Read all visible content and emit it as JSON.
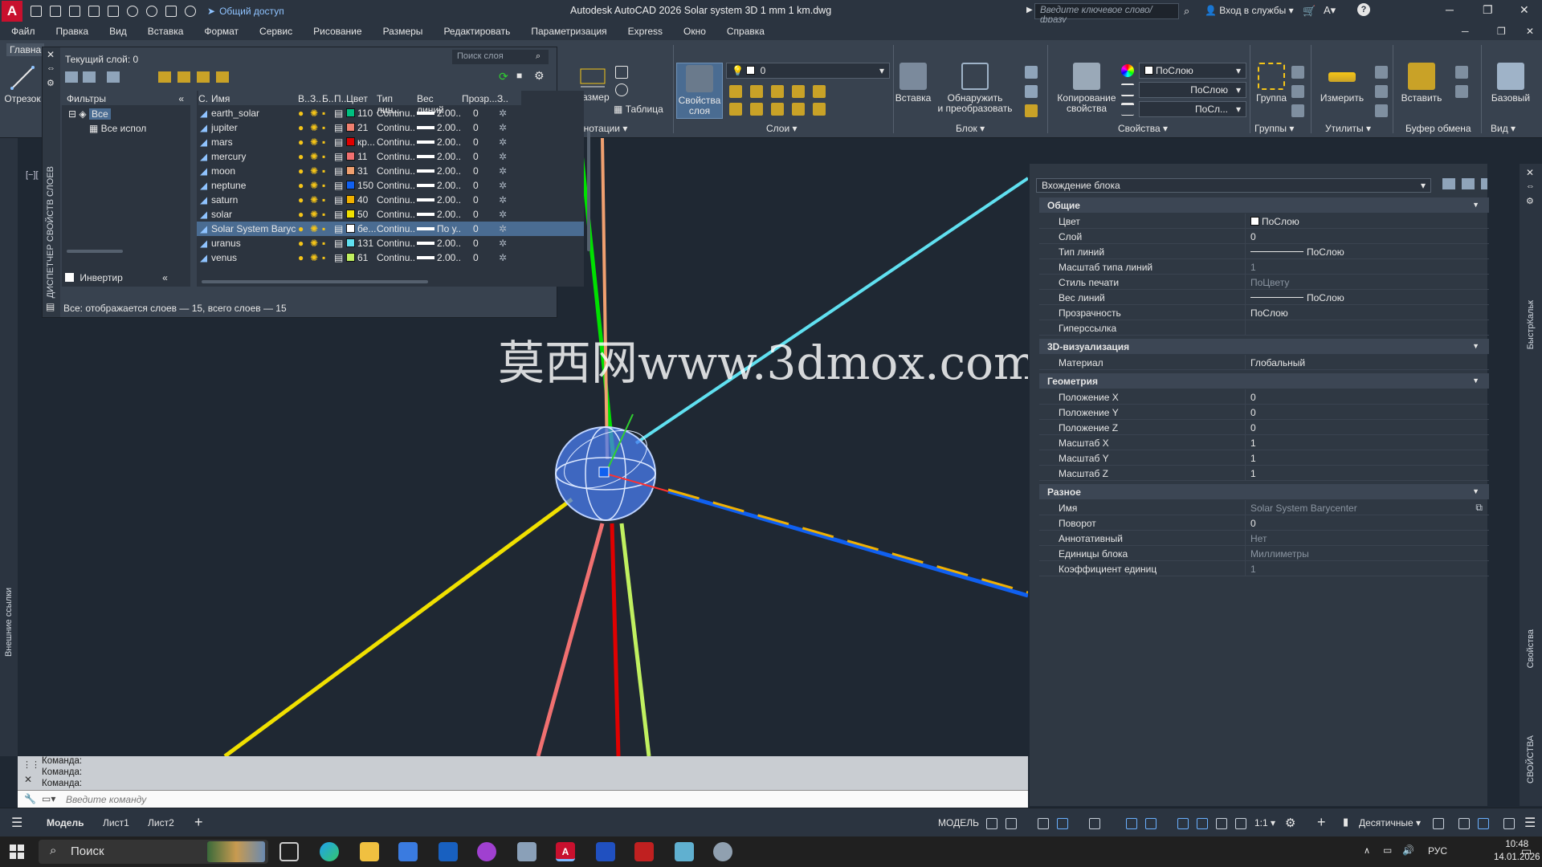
{
  "titlebar": {
    "share_label": "Общий доступ",
    "title": "Autodesk AutoCAD 2026   Solar system 3D  1 mm 1 km.dwg",
    "search_placeholder": "Введите ключевое слово/фразу",
    "login_label": "Вход в службы"
  },
  "menu": [
    "Файл",
    "Правка",
    "Вид",
    "Вставка",
    "Формат",
    "Сервис",
    "Рисование",
    "Размеры",
    "Редактировать",
    "Параметризация",
    "Express",
    "Окно",
    "Справка"
  ],
  "ribbon": {
    "home_tab": "Главна",
    "line_tool": "Отрезок",
    "dimension": "Размер",
    "table": "Таблица",
    "annotations_group": "Аннотации",
    "layer_props": [
      "Свойства",
      "слоя"
    ],
    "layer_combo": "0",
    "layers_group": "Слои",
    "insert": "Вставка",
    "discover": [
      "Обнаружить",
      "и преобразовать"
    ],
    "block_group": "Блок",
    "copy_props": [
      "Копирование",
      "свойства"
    ],
    "props_group": "Свойства",
    "color_combo": "ПоСлою",
    "ltype_combo": "ПоСлою",
    "lweight_combo": "ПоСл...",
    "group": "Группа",
    "groups_group": "Группы",
    "measure": "Измерить",
    "utils_group": "Утилиты",
    "paste": "Вставить",
    "clipboard_group": "Буфер обмена",
    "base": "Базовый",
    "view_group": "Вид"
  },
  "layer_manager": {
    "vertical_title": "ДИСПЕТЧЕР СВОЙСТВ СЛОЕВ",
    "current_layer": "Текущий слой: 0",
    "search_placeholder": "Поиск слоя",
    "filters_label": "Фильтры",
    "tree_all": "Все",
    "tree_used": "Все испол",
    "invert_label": "Инвертир",
    "status": "Все: отображается слоев — 15, всего слоев — 15",
    "columns": [
      "С.",
      "Имя",
      "В..",
      "З..",
      "Б..",
      "П..",
      "Цвет",
      "Тип лин...",
      "Вес линий",
      "Прозр...",
      "З.."
    ],
    "rows": [
      {
        "name": "earth_solar",
        "color_hex": "#00c080",
        "color": "110",
        "ltype": "Continu...",
        "lweight": "2.00...",
        "transp": "0"
      },
      {
        "name": "jupiter",
        "color_hex": "#f08070",
        "color": "21",
        "ltype": "Continu...",
        "lweight": "2.00...",
        "transp": "0"
      },
      {
        "name": "mars",
        "color_hex": "#e00000",
        "color": "кр...",
        "ltype": "Continu...",
        "lweight": "2.00...",
        "transp": "0"
      },
      {
        "name": "mercury",
        "color_hex": "#f07070",
        "color": "11",
        "ltype": "Continu...",
        "lweight": "2.00...",
        "transp": "0"
      },
      {
        "name": "moon",
        "color_hex": "#f0a070",
        "color": "31",
        "ltype": "Continu...",
        "lweight": "2.00...",
        "transp": "0"
      },
      {
        "name": "neptune",
        "color_hex": "#1060f0",
        "color": "150",
        "ltype": "Continu...",
        "lweight": "2.00...",
        "transp": "0"
      },
      {
        "name": "saturn",
        "color_hex": "#f0b000",
        "color": "40",
        "ltype": "Continu...",
        "lweight": "2.00...",
        "transp": "0"
      },
      {
        "name": "solar",
        "color_hex": "#f0e000",
        "color": "50",
        "ltype": "Continu...",
        "lweight": "2.00...",
        "transp": "0"
      },
      {
        "name": "Solar System Barycen...",
        "color_hex": "#ffffff",
        "color": "бе...",
        "ltype": "Continu...",
        "lweight": "По у...",
        "transp": "0",
        "selected": true
      },
      {
        "name": "uranus",
        "color_hex": "#60e0f0",
        "color": "131",
        "ltype": "Continu...",
        "lweight": "2.00...",
        "transp": "0"
      },
      {
        "name": "venus",
        "color_hex": "#c0f060",
        "color": "61",
        "ltype": "Continu...",
        "lweight": "2.00...",
        "transp": "0"
      }
    ]
  },
  "viewport": {
    "view_label": "[−][",
    "watermark": "莫西网www.3dmox.com"
  },
  "properties": {
    "object_type": "Вхождение блока",
    "sections": {
      "general": "Общие",
      "viz3d": "3D-визуализация",
      "geometry": "Геометрия",
      "misc": "Разное"
    },
    "general": [
      {
        "key": "Цвет",
        "value": "ПоСлою"
      },
      {
        "key": "Слой",
        "value": "0"
      },
      {
        "key": "Тип линий",
        "value": "ПоСлою"
      },
      {
        "key": "Масштаб типа линий",
        "value": "1"
      },
      {
        "key": "Стиль печати",
        "value": "ПоЦвету"
      },
      {
        "key": "Вес линий",
        "value": "ПоСлою"
      },
      {
        "key": "Прозрачность",
        "value": "ПоСлою"
      },
      {
        "key": "Гиперссылка",
        "value": ""
      }
    ],
    "viz3d": [
      {
        "key": "Материал",
        "value": "Глобальный"
      }
    ],
    "geometry": [
      {
        "key": "Положение X",
        "value": "0"
      },
      {
        "key": "Положение Y",
        "value": "0"
      },
      {
        "key": "Положение Z",
        "value": "0"
      },
      {
        "key": "Масштаб X",
        "value": "1"
      },
      {
        "key": "Масштаб Y",
        "value": "1"
      },
      {
        "key": "Масштаб Z",
        "value": "1"
      }
    ],
    "misc": [
      {
        "key": "Имя",
        "value": "Solar System Barycenter"
      },
      {
        "key": "Поворот",
        "value": "0"
      },
      {
        "key": "Аннотативный",
        "value": "Нет"
      },
      {
        "key": "Единицы блока",
        "value": "Миллиметры"
      },
      {
        "key": "Коэффициент единиц",
        "value": "1"
      }
    ]
  },
  "side_labels": {
    "left_ext": "Внешние ссылки",
    "right_quickcalc": "БыстрКальк",
    "right_props": "Свойства",
    "right_props_caps": "СВОЙСТВА"
  },
  "command": {
    "lines": [
      "Команда:",
      "Команда:",
      "Команда:"
    ],
    "placeholder": "Введите команду"
  },
  "status": {
    "tabs": [
      "Модель",
      "Лист1",
      "Лист2"
    ],
    "model": "МОДЕЛЬ",
    "scale": "1:1",
    "units": "Десятичные"
  },
  "taskbar": {
    "search": "Поиск",
    "lang": "РУС",
    "time": "10:48",
    "date": "14.01.2026"
  }
}
